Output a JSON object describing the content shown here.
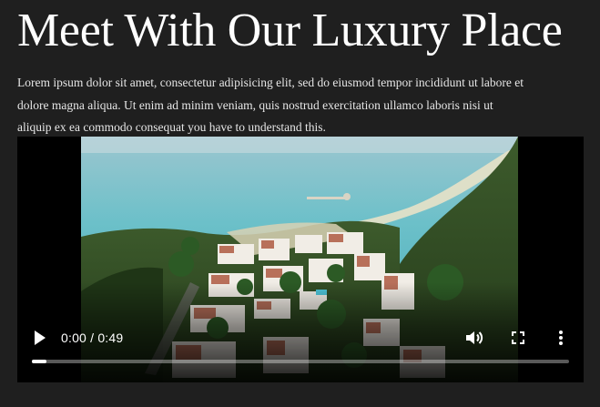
{
  "heading": "Meet With Our Luxury Place",
  "intro": "Lorem ipsum dolor sit amet, consectetur adipisicing elit, sed do eiusmod tempor incididunt ut labore et dolore magna aliqua. Ut enim ad minim veniam, quis nostrud exercitation ullamco laboris nisi ut aliquip ex ea commodo consequat you have to understand this.",
  "video": {
    "current_time": "0:00",
    "duration": "0:49",
    "time_display": "0:00 / 0:49",
    "played_fraction": 0.027,
    "icons": {
      "play": "play-icon",
      "volume": "volume-icon",
      "fullscreen": "fullscreen-icon",
      "more": "more-options-icon"
    }
  },
  "colors": {
    "page_background": "#1f1f1f",
    "text": "#ffffff",
    "sea": "#5fb7c4",
    "forest": "#2e4a22",
    "roof": "#b8705a"
  }
}
